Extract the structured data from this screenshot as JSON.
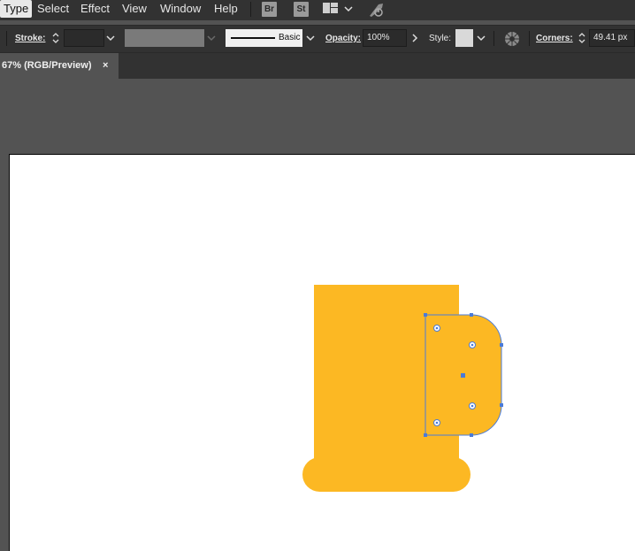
{
  "menubar": {
    "items": [
      "Type",
      "Select",
      "Effect",
      "View",
      "Window",
      "Help"
    ],
    "bridge_label": "Br",
    "stock_label": "St"
  },
  "controlbar": {
    "stroke_label": "Stroke:",
    "brush_label": "Basic",
    "opacity_label": "Opacity:",
    "opacity_value": "100%",
    "style_label": "Style:",
    "corners_label": "Corners:",
    "corners_value": "49.41 px"
  },
  "document": {
    "tab_title": "67% (RGB/Preview)",
    "close_symbol": "×"
  },
  "colors": {
    "mug_fill": "#FCB823",
    "selection": "#4A7BD8",
    "artboard": "#FFFFFF",
    "pasteboard": "#535353"
  },
  "icons": [
    "chevron-down-icon",
    "workspace-icon",
    "gpu-rocket-icon",
    "recolor-artwork-icon",
    "spinner-icon"
  ]
}
